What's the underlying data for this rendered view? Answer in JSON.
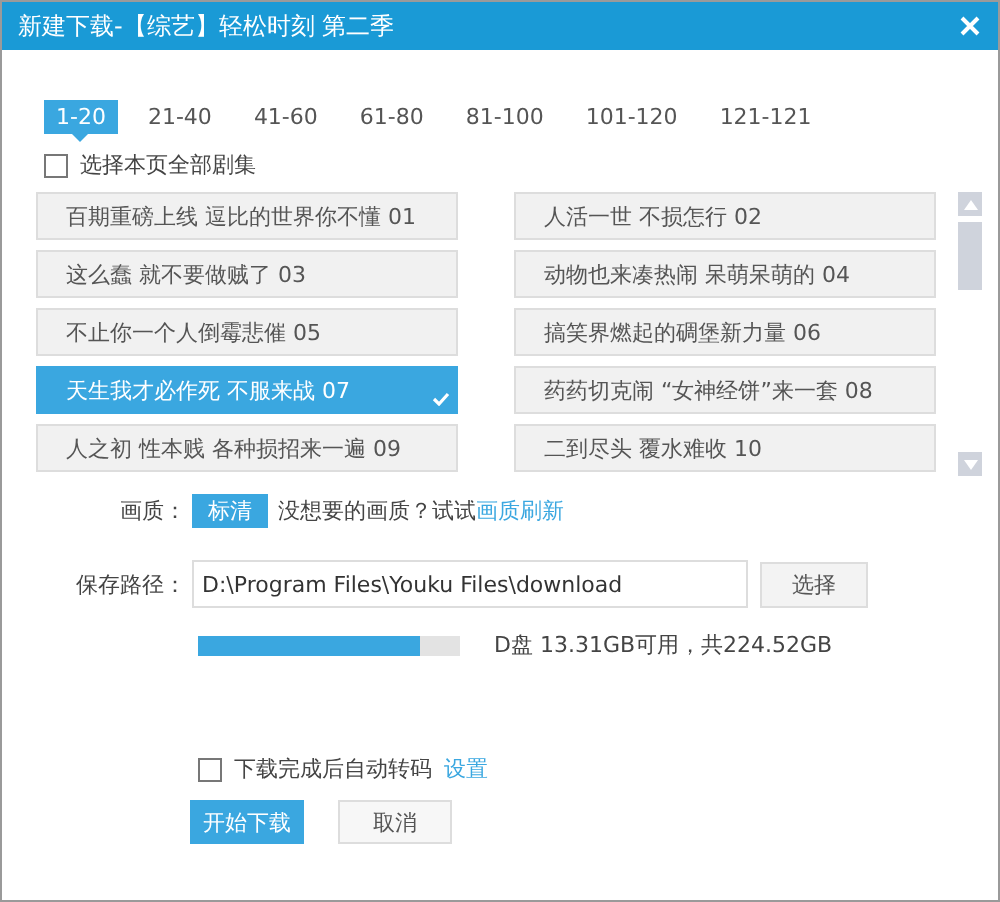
{
  "window": {
    "title": "新建下载-【综艺】轻松时刻 第二季"
  },
  "tabs": [
    {
      "label": "1-20",
      "selected": true
    },
    {
      "label": "21-40",
      "selected": false
    },
    {
      "label": "41-60",
      "selected": false
    },
    {
      "label": "61-80",
      "selected": false
    },
    {
      "label": "81-100",
      "selected": false
    },
    {
      "label": "101-120",
      "selected": false
    },
    {
      "label": "121-121",
      "selected": false
    }
  ],
  "select_all": {
    "label": "选择本页全部剧集",
    "checked": false
  },
  "episodes": [
    {
      "label": "百期重磅上线 逗比的世界你不懂 01",
      "selected": false
    },
    {
      "label": "人活一世 不损怎行 02",
      "selected": false
    },
    {
      "label": "这么蠢 就不要做贼了 03",
      "selected": false
    },
    {
      "label": "动物也来凑热闹 呆萌呆萌的 04",
      "selected": false
    },
    {
      "label": "不止你一个人倒霉悲催 05",
      "selected": false
    },
    {
      "label": "搞笑界燃起的碉堡新力量 06",
      "selected": false
    },
    {
      "label": "天生我才必作死 不服来战 07",
      "selected": true
    },
    {
      "label": "药药切克闹 “女神经饼”来一套 08",
      "selected": false
    },
    {
      "label": "人之初 性本贱 各种损招来一遍 09",
      "selected": false
    },
    {
      "label": "二到尽头 覆水难收 10",
      "selected": false
    }
  ],
  "quality": {
    "label": "画质：",
    "option": "标清",
    "hint": "没想要的画质？试试",
    "link": "画质刷新"
  },
  "save_path": {
    "label": "保存路径：",
    "value": "D:\\Program Files\\Youku Files\\download",
    "button": "选择"
  },
  "disk": {
    "level": 0.85,
    "text": "D盘 13.31GB可用，共224.52GB"
  },
  "auto_transcode": {
    "label": "下载完成后自动转码",
    "checked": false,
    "link": "设置"
  },
  "buttons": [
    {
      "label": "开始下载",
      "kind": "primary"
    },
    {
      "label": "取消",
      "kind": "secondary"
    }
  ]
}
